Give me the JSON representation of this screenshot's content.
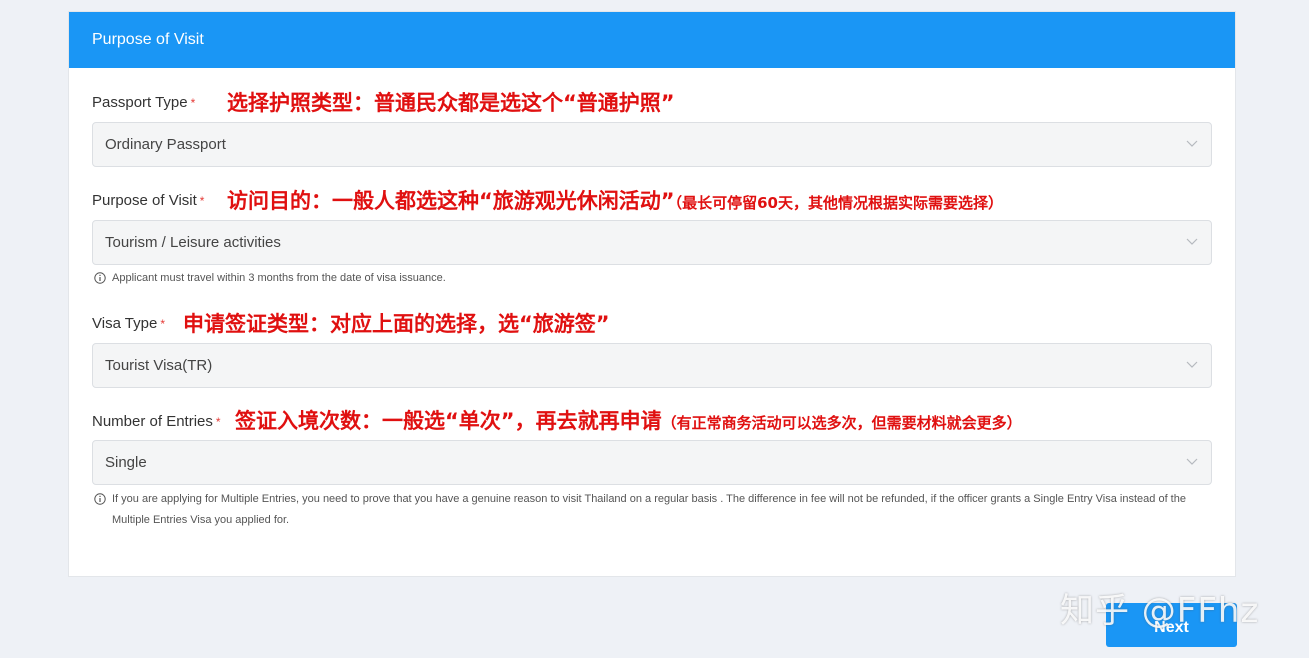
{
  "card": {
    "title": "Purpose of Visit"
  },
  "fields": {
    "passport_type": {
      "label": "Passport Type",
      "required_mark": "*",
      "value": "Ordinary Passport",
      "annotation": "选择护照类型：普通民众都是选这个“普通护照”"
    },
    "purpose": {
      "label": "Purpose of Visit",
      "required_mark": "*",
      "value": "Tourism / Leisure activities",
      "annotation": "访问目的：一般人都选这种“旅游观光休闲活动”",
      "annotation_note": "（最长可停留60天，其他情况根据实际需要选择）",
      "hint": "Applicant must travel within 3 months from the date of visa issuance."
    },
    "visa_type": {
      "label": "Visa Type",
      "required_mark": "*",
      "value": "Tourist Visa(TR)",
      "annotation": "申请签证类型：对应上面的选择，选“旅游签”"
    },
    "entries": {
      "label": "Number of Entries",
      "required_mark": "*",
      "value": "Single",
      "annotation": "签证入境次数：一般选“单次”，再去就再申请",
      "annotation_note": "（有正常商务活动可以选多次，但需要材料就会更多）",
      "hint": "If you are applying for Multiple Entries, you need to prove that you have a genuine reason to visit Thailand on a regular basis . The difference in fee will not be refunded, if the officer grants a Single Entry Visa instead of the Multiple Entries Visa you applied for."
    }
  },
  "actions": {
    "next_label": "Next"
  },
  "watermark": "知乎 @FFhz",
  "icons": {
    "select_arrow": "chevron-down-icon",
    "hint": "info-icon"
  },
  "colors": {
    "accent": "#1a96f5",
    "annotation": "#e01010",
    "required": "#e53935"
  }
}
